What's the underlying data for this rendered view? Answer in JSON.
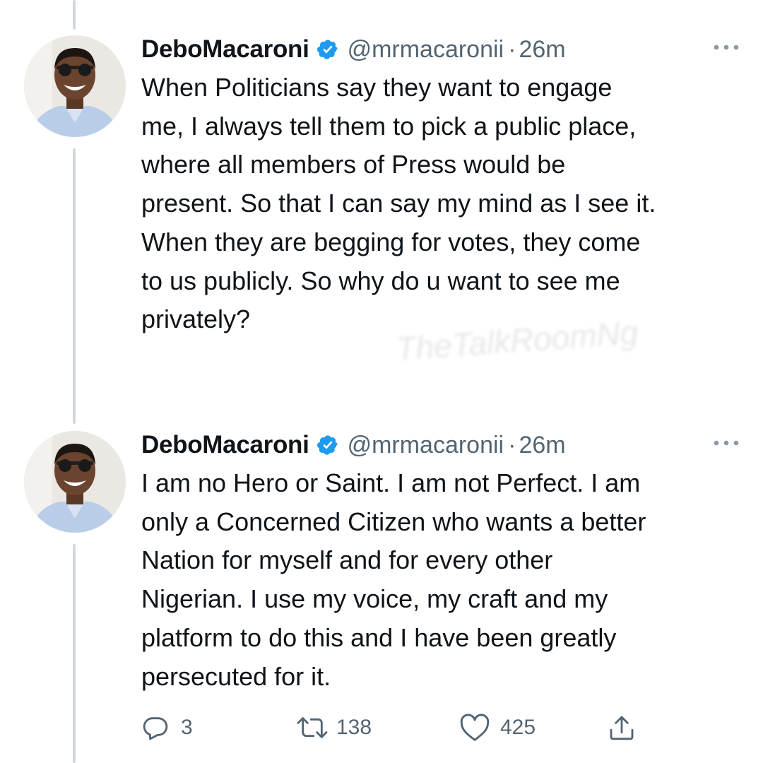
{
  "tweets": [
    {
      "display_name": "DeboMacaroni",
      "handle": "@mrmacaronii",
      "separator": "·",
      "time": "26m",
      "lines": [
        "When Politicians say they want to engage",
        "me, I always tell them to pick a public place,",
        "where all members of Press would be",
        "present. So that I can say my mind as I see it.",
        "When they are begging for votes, they come",
        "to us publicly. So why do u want to see me",
        "privately?"
      ]
    },
    {
      "display_name": "DeboMacaroni",
      "handle": "@mrmacaronii",
      "separator": "·",
      "time": "26m",
      "lines": [
        "I am no Hero or Saint. I am not Perfect. I am",
        "only a Concerned Citizen who wants a better",
        "Nation for myself and for every other",
        "Nigerian. I use my voice, my craft and my",
        "platform to do this and I have been greatly",
        "persecuted for it."
      ]
    }
  ],
  "actions": {
    "replies": "3",
    "retweets": "138",
    "likes": "425"
  },
  "watermark": "TheTalkRoomNg",
  "colors": {
    "verified": "#1d9bf0",
    "secondary_text": "#536471",
    "thread_line": "#cfd9de"
  },
  "icons": [
    "verified-badge-icon",
    "more-icon",
    "reply-icon",
    "retweet-icon",
    "like-icon",
    "share-icon"
  ]
}
